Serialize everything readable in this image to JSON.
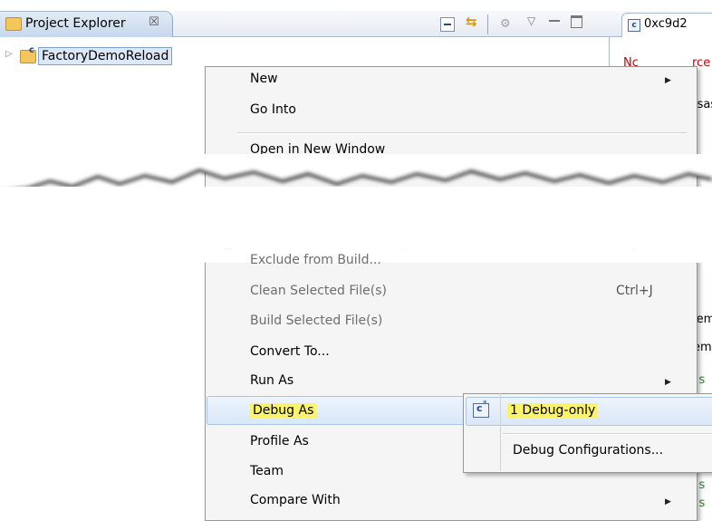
{
  "project_explorer": {
    "tab_title": "Project Explorer",
    "close_glyph": "☒",
    "project_name": "FactoryDemoReload"
  },
  "editor": {
    "tab_title": "0xc9d2",
    "fragments": [
      "Nc",
      "rce",
      "isas",
      "lem",
      "em",
      "r s",
      "r s",
      "r s",
      "r s"
    ]
  },
  "context_menu": {
    "top_items": [
      {
        "label": "New",
        "has_submenu": true
      },
      {
        "label": "Go Into",
        "has_submenu": false
      },
      {
        "label": "Open in New Window",
        "has_submenu": false
      }
    ],
    "bottom_items": [
      {
        "label": "Exclude from Build...",
        "enabled": false
      },
      {
        "label": "Clean Selected File(s)",
        "enabled": false,
        "accelerator": "Ctrl+J"
      },
      {
        "label": "Build Selected File(s)",
        "enabled": false
      },
      {
        "label": "Convert To...",
        "enabled": true
      },
      {
        "label": "Run As",
        "enabled": true,
        "has_submenu": true
      },
      {
        "label": "Debug As",
        "enabled": true,
        "has_submenu": true,
        "highlighted": true
      },
      {
        "label": "Profile As",
        "enabled": true
      },
      {
        "label": "Team",
        "enabled": true
      },
      {
        "label": "Compare With",
        "enabled": true,
        "has_submenu": true
      }
    ]
  },
  "submenu": {
    "items": [
      {
        "label": "1 Debug-only",
        "highlighted": true
      },
      {
        "label": "Debug Configurations..."
      }
    ]
  },
  "colors": {
    "highlight_yellow": "#fbf46a",
    "selection_blue": "#d9e7f8",
    "editor_error_red": "#d00000"
  }
}
